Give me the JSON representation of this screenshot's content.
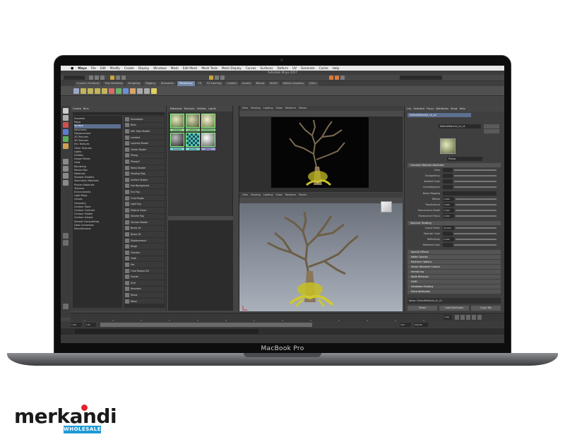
{
  "device": {
    "label": "MacBook Pro"
  },
  "watermark": {
    "brand": "merkandi",
    "sub": "WHOLESALE"
  },
  "app": {
    "window_title": "Autodesk Maya 2017",
    "menu": [
      "Maya",
      "File",
      "Edit",
      "Modify",
      "Create",
      "Display",
      "Windows",
      "Mesh",
      "Edit Mesh",
      "Mesh Tools",
      "Mesh Display",
      "Curves",
      "Surfaces",
      "Deform",
      "UV",
      "Generate",
      "Cache",
      "Help"
    ],
    "shelf_tabs": [
      "Curves / Surfaces",
      "Poly Modeling",
      "Sculpting",
      "Rigging",
      "Animation",
      "Rendering",
      "FX",
      "FX Caching",
      "Custom",
      "Arnold",
      "Bifrost",
      "MASH",
      "Motion Graphics",
      "XGen"
    ],
    "active_shelf": "Rendering",
    "hypershade": {
      "tabs": [
        "Create",
        "Bins"
      ],
      "tree": [
        "Favorites",
        "Maya",
        "Surface",
        "Volumetric",
        "Displacement",
        "2D Textures",
        "3D Textures",
        "Env Textures",
        "Other Textures",
        "Lights",
        "Utilities",
        "Image Planes",
        "Glow",
        "Rendering",
        "Mental Ray",
        "Materials",
        "Shadow Shaders",
        "Volumetric Materials",
        "Photon Materials",
        "Textures",
        "Environments",
        "Light Maps",
        "Lenses",
        "Geometry",
        "Contour Store",
        "Contour Contrast",
        "Contour Shader",
        "Contour Output",
        "Sample Compositing",
        "Data Conversion",
        "Miscellaneous"
      ],
      "selected_tree": "Surface",
      "nodes": [
        "Anisotropic",
        "Blinn",
        "Hair Tube Shader",
        "Lambert",
        "Layered Shader",
        "Ocean Shader",
        "Phong",
        "Phong E",
        "Ramp Shader",
        "Shading Map",
        "Surface Shader",
        "Use Background",
        "Env Fog",
        "Fluid Shape",
        "Light Fog",
        "Particle Cloud",
        "Volume Fog",
        "Volume Shader",
        "Bump 2d",
        "Bump 3d",
        "Displacement",
        "Bulge",
        "Checker",
        "Cloth",
        "File",
        "Fluid Texture 2D",
        "Fractal",
        "Grid",
        "Mountain",
        "Movie",
        "Noise",
        "Ocean",
        "PSD File",
        "Ramp",
        "Water"
      ]
    },
    "swatches": {
      "tabs": [
        "Materials",
        "Textures",
        "Utilities",
        "Lights"
      ],
      "items": [
        "lambert1",
        "particleCl",
        "shaderGlow",
        "lambert2",
        "phong1",
        "blinn1"
      ]
    },
    "viewport": {
      "top_menu": [
        "View",
        "Shading",
        "Lighting",
        "Show",
        "Renderer",
        "Panels"
      ],
      "main_menu": [
        "View",
        "Shading",
        "Lighting",
        "Show",
        "Renderer",
        "Panels"
      ]
    },
    "attribute_editor": {
      "tabs": [
        "List",
        "Selected",
        "Focus",
        "Attributes",
        "Show",
        "Help"
      ],
      "node_name": "DefaultMaterial_ch_v4",
      "type_label": "Phong",
      "sections": [
        "Common Material Attributes",
        "Specular Shading",
        "Special Effects",
        "Matte Opacity",
        "Raytrace Options",
        "Vector Renderer Control",
        "mental ray",
        "Node Behavior",
        "UUID",
        "Hardware Shading",
        "Extra Attributes"
      ],
      "attrs": [
        "Color",
        "Transparency",
        "Ambient Color",
        "Incandescence",
        "Bump Mapping",
        "Diffuse",
        "Translucence",
        "Translucence Depth",
        "Translucence Focus",
        "Cosine Power",
        "Specular Color",
        "Reflectivity",
        "Reflected Color"
      ],
      "values": [
        "1.000",
        "0.000",
        "0.500",
        "0.500",
        "20.000",
        "0.500"
      ],
      "buttons": [
        "Select",
        "Load Attributes",
        "Copy Tab"
      ],
      "notes_label": "Notes: DefaultMaterial_ch_v4"
    },
    "timeline": {
      "start": "1.00",
      "end": "120",
      "range_end": "200.00",
      "current": "1.00"
    }
  }
}
